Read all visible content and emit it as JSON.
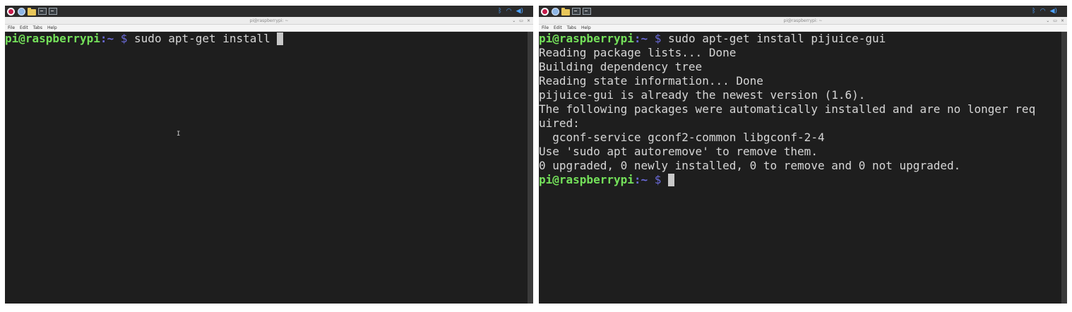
{
  "left": {
    "window_title": "pi@raspberrypi: ~",
    "menu": [
      "File",
      "Edit",
      "Tabs",
      "Help"
    ],
    "window_controls": [
      "⌄",
      "▭",
      "×"
    ],
    "prompt": {
      "user_host": "pi@raspberrypi",
      "path": ":~",
      "dollar": "$"
    },
    "command": " sudo apt-get install "
  },
  "right": {
    "window_title": "pi@raspberrypi: ~",
    "menu": [
      "File",
      "Edit",
      "Tabs",
      "Help"
    ],
    "window_controls": [
      "⌄",
      "▭",
      "×"
    ],
    "prompt": {
      "user_host": "pi@raspberrypi",
      "path": ":~",
      "dollar": "$"
    },
    "command": " sudo apt-get install pijuice-gui",
    "output": [
      "Reading package lists... Done",
      "Building dependency tree",
      "Reading state information... Done",
      "pijuice-gui is already the newest version (1.6).",
      "The following packages were automatically installed and are no longer req",
      "uired:",
      "  gconf-service gconf2-common libgconf-2-4",
      "Use 'sudo apt autoremove' to remove them.",
      "0 upgraded, 0 newly installed, 0 to remove and 0 not upgraded."
    ],
    "final_prompt": {
      "user_host": "pi@raspberrypi",
      "path": ":~",
      "dollar": "$"
    }
  },
  "taskbar": {
    "icons": [
      "raspberry-menu-icon",
      "web-browser-icon",
      "file-manager-icon",
      "terminal-icon",
      "terminal-icon"
    ],
    "tray": [
      "bluetooth-icon",
      "wifi-icon",
      "volume-icon"
    ]
  },
  "colors": {
    "terminal_bg": "#1e1e1e",
    "prompt_user": "#74e05a",
    "prompt_path": "#6a6ad8",
    "text": "#d6d6d6"
  }
}
